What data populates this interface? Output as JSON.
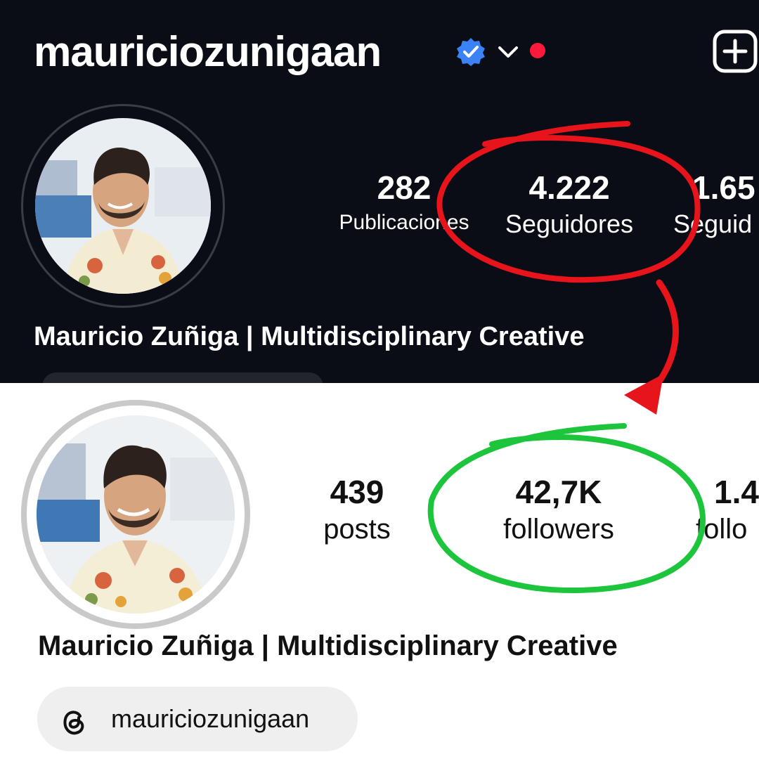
{
  "dark_profile": {
    "username": "mauriciozunigaan",
    "display_name": "Mauricio Zuñiga | Multidisciplinary Creative",
    "stats": [
      {
        "value": "282",
        "label": "Publicaciones"
      },
      {
        "value": "4.222",
        "label": "Seguidores"
      },
      {
        "value": "1.65",
        "label": "Seguid"
      }
    ],
    "icons": [
      "verified-badge-icon",
      "chevron-down-icon",
      "notification-dot-icon",
      "new-post-icon"
    ]
  },
  "light_profile": {
    "display_name": "Mauricio Zuñiga | Multidisciplinary Creative",
    "stats": [
      {
        "value": "439",
        "label": "posts"
      },
      {
        "value": "42,7K",
        "label": "followers"
      },
      {
        "value": "1.4",
        "label": "follo"
      }
    ],
    "threads_handle": "mauriciozunigaan",
    "icons": [
      "threads-icon"
    ]
  },
  "annotations": {
    "red_circle_color": "#e8141b",
    "green_circle_color": "#1dc53c",
    "arrow_color": "#e8141b"
  }
}
